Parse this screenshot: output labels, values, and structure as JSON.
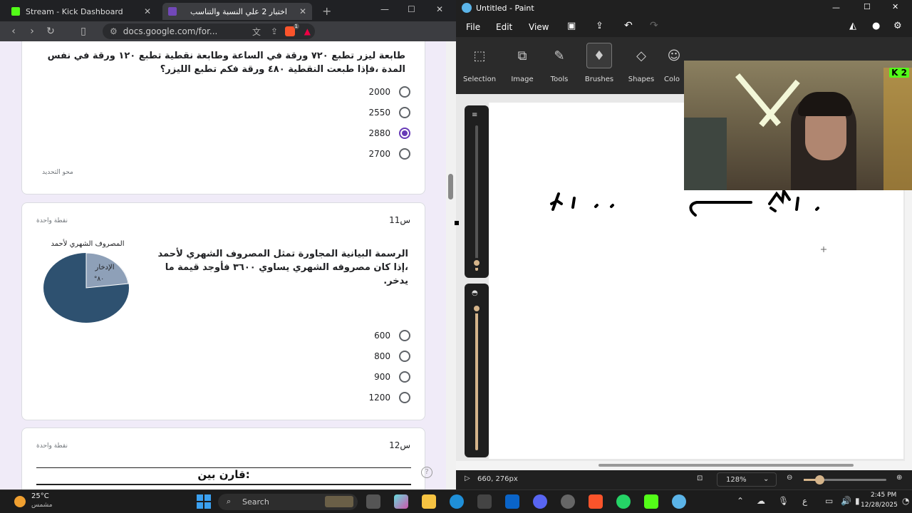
{
  "browser": {
    "tabs": [
      {
        "title": "Stream - Kick Dashboard",
        "active": false
      },
      {
        "title": "اختبار 2 علي النسبة والتناسب",
        "active": true
      }
    ],
    "url": "docs.google.com/for...",
    "extension_badge": "1"
  },
  "form": {
    "q10": {
      "text": "طابعة ليزر تطبع ٧٢٠ ورقة في الساعة وطابعة نقطية تطبع ١٢٠ ورقة في نفس المدة ،فإذا طبعت النقطية ٤٨٠ ورقة فكم تطبع الليزر؟",
      "options": [
        "2000",
        "2550",
        "2880",
        "2700"
      ],
      "selected": "2880",
      "clear": "محو التحديد"
    },
    "q11": {
      "number": "س11",
      "points": "نقطة واحدة",
      "text": "الرسمة البيانية المجاورة تمثل المصروف الشهري لأحمد ،إذا كان مصروفه الشهري يساوي ٣٦٠٠ فأوجد قيمة ما يدخر.",
      "chart_title": "المصروف الشهري لأحمد",
      "slice_label": "الإدخار",
      "slice_value": "°٨٠",
      "options": [
        "600",
        "800",
        "900",
        "1200"
      ]
    },
    "q12": {
      "number": "س12",
      "points": "نقطة واحدة",
      "heading": "قارن بين:"
    }
  },
  "paint": {
    "title": "Untitled - Paint",
    "menu": [
      "File",
      "Edit",
      "View"
    ],
    "tools": [
      "Selection",
      "Image",
      "Tools",
      "Brushes",
      "Shapes",
      "Colo"
    ],
    "status_coords": "660, 276px",
    "zoom": "128%",
    "webcam_badge": "2"
  },
  "taskbar": {
    "weather_temp": "25°C",
    "weather_desc": "مشمس",
    "search_label": "Search",
    "lang": "ع",
    "time": "2:45 PM",
    "date": "12/28/2025"
  },
  "colors": {
    "form_bg": "#f0ebf8",
    "radio_accent": "#673ab7",
    "pie_main": "#2e5170",
    "pie_slice": "#8ea0b8"
  }
}
